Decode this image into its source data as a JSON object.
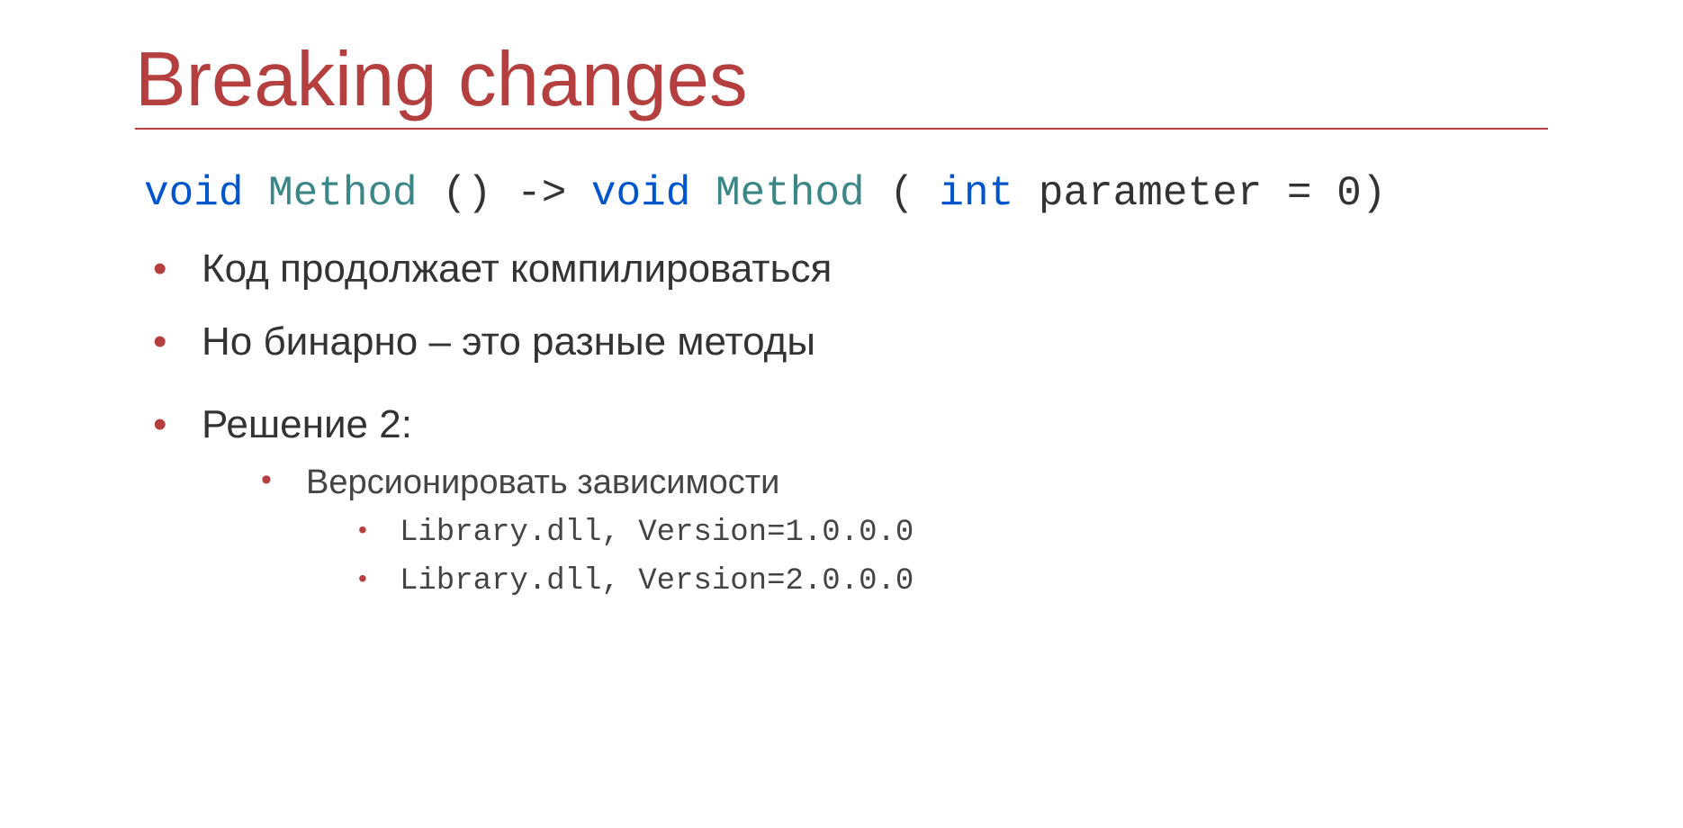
{
  "title": "Breaking changes",
  "code": {
    "v1": "void",
    "m1": "Method",
    "p1": "() -> ",
    "v2": "void",
    "m2": "Method",
    "p2": "(",
    "intkw": "int",
    "p3": " parameter = 0)"
  },
  "bullets": [
    "Код продолжает компилироваться",
    "Но бинарно – это разные методы",
    "Решение 2:"
  ],
  "sub": {
    "heading": "Версионировать зависимости",
    "items": [
      "Library.dll, Version=1.0.0.0",
      "Library.dll, Version=2.0.0.0"
    ]
  }
}
